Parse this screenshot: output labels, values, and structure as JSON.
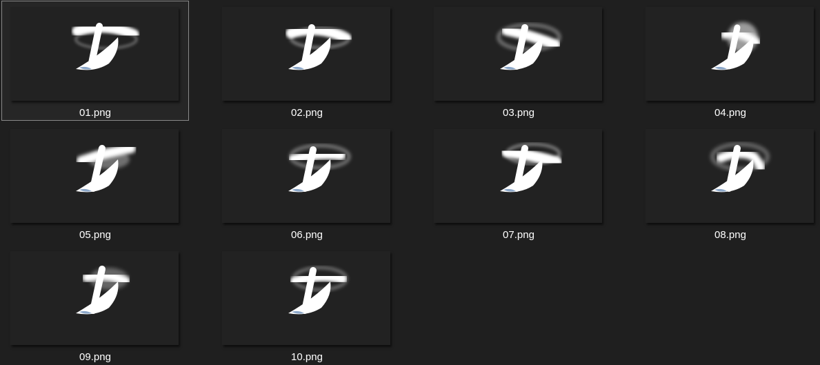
{
  "explorer": {
    "items": [
      {
        "name": "01.png",
        "selected": true
      },
      {
        "name": "02.png",
        "selected": false
      },
      {
        "name": "03.png",
        "selected": false
      },
      {
        "name": "04.png",
        "selected": false
      },
      {
        "name": "05.png",
        "selected": false
      },
      {
        "name": "06.png",
        "selected": false
      },
      {
        "name": "07.png",
        "selected": false
      },
      {
        "name": "08.png",
        "selected": false
      },
      {
        "name": "09.png",
        "selected": false
      },
      {
        "name": "10.png",
        "selected": false
      }
    ]
  },
  "colors": {
    "background": "#1f1f1f",
    "thumb_background": "#222222",
    "selection_border": "#8a8a8a",
    "label_text": "#ffffff",
    "glyph_accent": "#8aa6c8"
  }
}
